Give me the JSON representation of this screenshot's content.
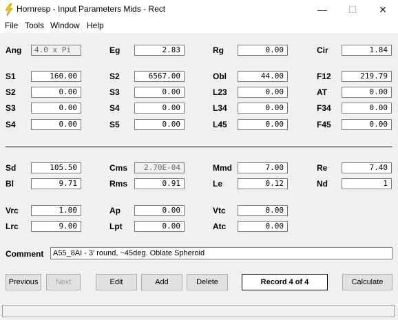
{
  "window": {
    "title": "Hornresp - Input Parameters   Mids - Rect"
  },
  "controls": {
    "minimize": "—",
    "maximize": "☐",
    "close": "✕"
  },
  "menu": [
    "File",
    "Tools",
    "Window",
    "Help"
  ],
  "params": {
    "ang": {
      "label": "Ang",
      "value": "4.0 x Pi"
    },
    "eg": {
      "label": "Eg",
      "value": "2.83"
    },
    "rg": {
      "label": "Rg",
      "value": "0.00"
    },
    "cir": {
      "label": "Cir",
      "value": "1.84"
    },
    "s1": {
      "label": "S1",
      "value": "160.00"
    },
    "s2a": {
      "label": "S2",
      "value": "6567.00"
    },
    "obl": {
      "label": "Obl",
      "value": "44.00"
    },
    "f12": {
      "label": "F12",
      "value": "219.79"
    },
    "s2": {
      "label": "S2",
      "value": "0.00"
    },
    "s3a": {
      "label": "S3",
      "value": "0.00"
    },
    "l23": {
      "label": "L23",
      "value": "0.00"
    },
    "at": {
      "label": "AT",
      "value": "0.00"
    },
    "s3": {
      "label": "S3",
      "value": "0.00"
    },
    "s4a": {
      "label": "S4",
      "value": "0.00"
    },
    "l34": {
      "label": "L34",
      "value": "0.00"
    },
    "f34": {
      "label": "F34",
      "value": "0.00"
    },
    "s4": {
      "label": "S4",
      "value": "0.00"
    },
    "s5": {
      "label": "S5",
      "value": "0.00"
    },
    "l45": {
      "label": "L45",
      "value": "0.00"
    },
    "f45": {
      "label": "F45",
      "value": "0.00"
    },
    "sd": {
      "label": "Sd",
      "value": "105.50"
    },
    "cms": {
      "label": "Cms",
      "value": "2.70E-04"
    },
    "mmd": {
      "label": "Mmd",
      "value": "7.00"
    },
    "re": {
      "label": "Re",
      "value": "7.40"
    },
    "bl": {
      "label": "Bl",
      "value": "9.71"
    },
    "rms": {
      "label": "Rms",
      "value": "0.91"
    },
    "le": {
      "label": "Le",
      "value": "0.12"
    },
    "nd": {
      "label": "Nd",
      "value": "1"
    },
    "vrc": {
      "label": "Vrc",
      "value": "1.00"
    },
    "ap": {
      "label": "Ap",
      "value": "0.00"
    },
    "vtc": {
      "label": "Vtc",
      "value": "0.00"
    },
    "lrc": {
      "label": "Lrc",
      "value": "9.00"
    },
    "lpt": {
      "label": "Lpt",
      "value": "0.00"
    },
    "atc": {
      "label": "Atc",
      "value": "0.00"
    }
  },
  "comment": {
    "label": "Comment",
    "value": "A55_8AI - 3' round, ~45deg. Oblate Spheroid"
  },
  "buttons": {
    "previous": "Previous",
    "next": "Next",
    "edit": "Edit",
    "add": "Add",
    "delete": "Delete",
    "record": "Record 4 of 4",
    "calculate": "Calculate"
  }
}
